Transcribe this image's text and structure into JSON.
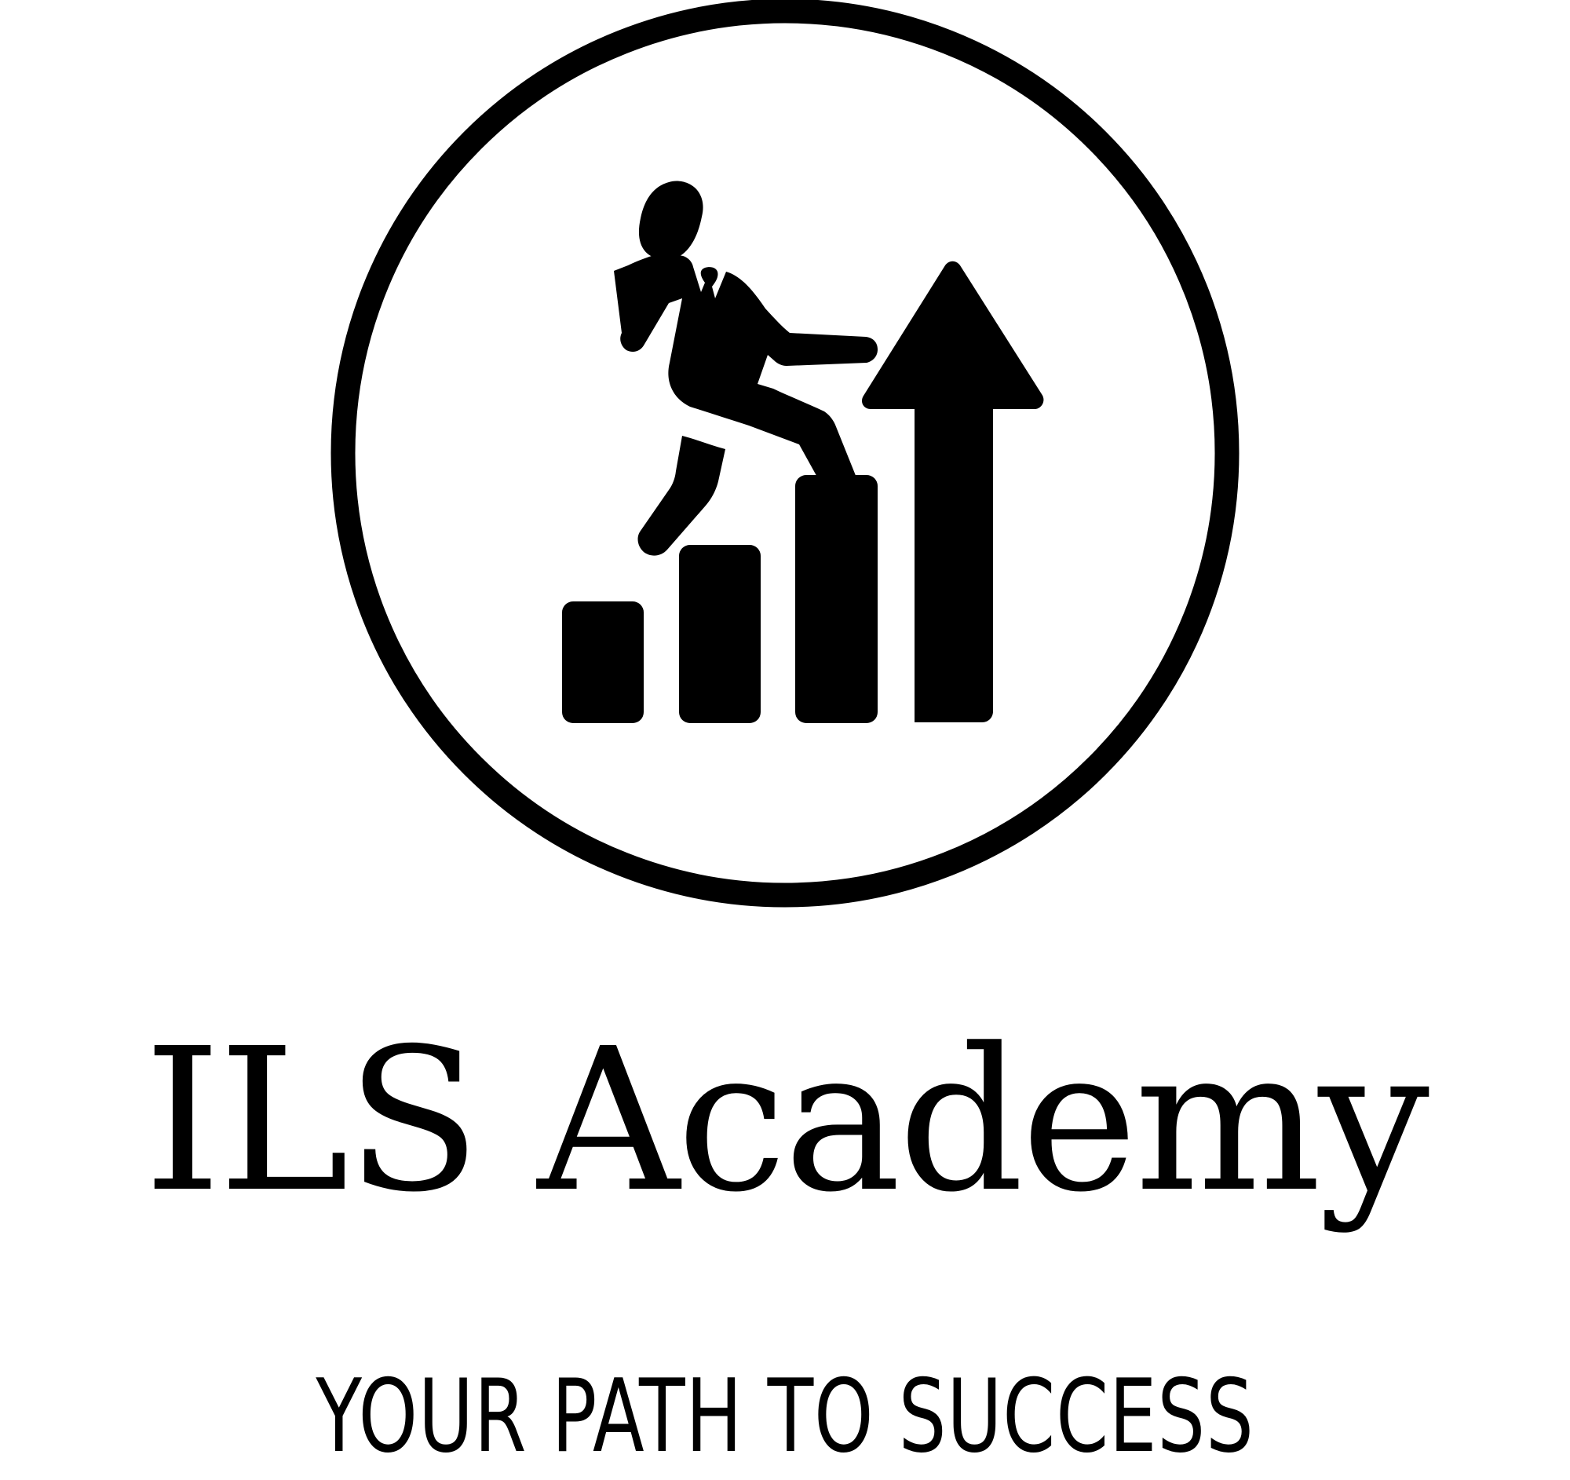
{
  "logo": {
    "icon": "businessman-climbing-bar-chart-icon",
    "color": "#000000",
    "background": "#ffffff"
  },
  "brand": {
    "name": "ILS Academy"
  },
  "tagline": {
    "text": "YOUR PATH TO SUCCESS"
  }
}
